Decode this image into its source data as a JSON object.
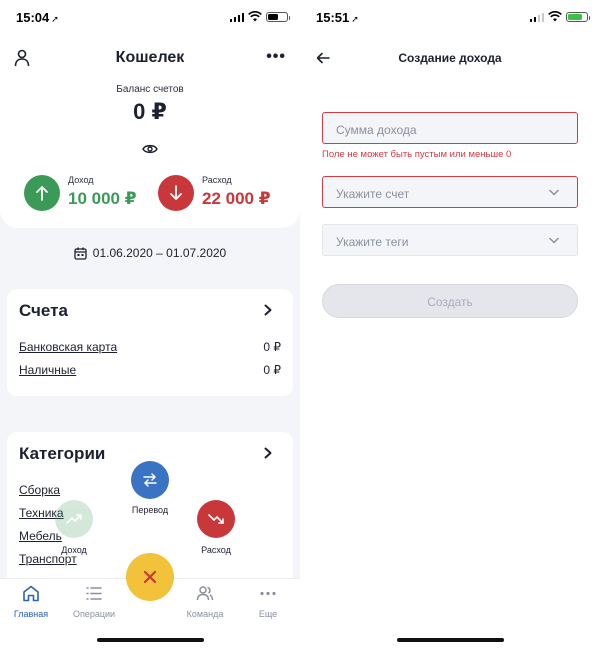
{
  "left_screen": {
    "status_bar": {
      "time": "15:04",
      "battery_level": 0.55
    },
    "header": {
      "title": "Кошелек"
    },
    "balance": {
      "label": "Баланс счетов",
      "value": "0 ₽"
    },
    "income": {
      "label": "Доход",
      "value": "10 000 ₽"
    },
    "expense": {
      "label": "Расход",
      "value": "22 000 ₽"
    },
    "period": {
      "text": "01.06.2020 – 01.07.2020"
    },
    "accounts": {
      "title": "Счета",
      "items": [
        {
          "name": "Банковская карта",
          "amount": "0 ₽"
        },
        {
          "name": "Наличные",
          "amount": "0 ₽"
        }
      ]
    },
    "categories": {
      "title": "Категории",
      "items": [
        "Сборка",
        "Техника",
        "Мебель",
        "Транспорт"
      ]
    },
    "fab_menu": {
      "transfer_label": "Перевод",
      "income_label": "Доход",
      "expense_label": "Расход"
    },
    "tabbar": {
      "items": [
        {
          "label": "Главная",
          "icon": "home-icon",
          "active": true
        },
        {
          "label": "Операции",
          "icon": "list-icon",
          "active": false
        },
        {
          "label": "Команда",
          "icon": "team-icon",
          "active": false
        },
        {
          "label": "Еще",
          "icon": "more-icon",
          "active": false
        }
      ]
    }
  },
  "right_screen": {
    "status_bar": {
      "time": "15:51",
      "battery_level": 0.8
    },
    "header": {
      "title": "Создание дохода"
    },
    "form": {
      "amount_placeholder": "Сумма дохода",
      "amount_error": "Поле не может быть пустым или меньше 0",
      "account_placeholder": "Укажите счет",
      "tags_placeholder": "Укажите теги",
      "submit_label": "Создать"
    }
  },
  "colors": {
    "income": "#3b9a57",
    "expense": "#c8373a",
    "transfer": "#3a72c4",
    "fab": "#f2c23a",
    "error": "#d23a45",
    "active_tab": "#2a62b5"
  }
}
